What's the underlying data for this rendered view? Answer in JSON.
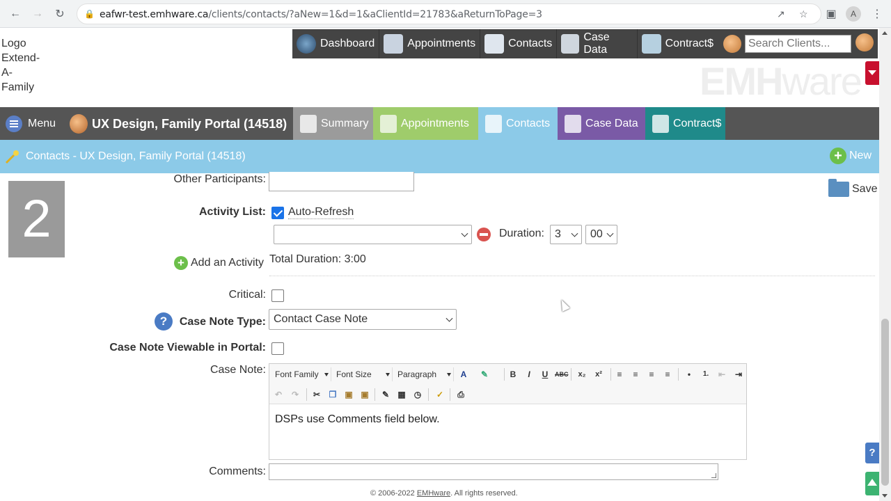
{
  "browser": {
    "url_host": "eafwr-test.emhware.ca",
    "url_rest": "/clients/contacts/?aNew=1&d=1&aClientId=21783&aReturnToPage=3",
    "profile_initial": "A"
  },
  "logo": {
    "alt_text": "Logo Extend-A-Family"
  },
  "top_nav": {
    "items": [
      {
        "label": "Dashboard",
        "icon": "dashboard-icon"
      },
      {
        "label": "Appointments",
        "icon": "calendar-icon"
      },
      {
        "label": "Contacts",
        "icon": "contacts-icon"
      },
      {
        "label": "Case Data",
        "icon": "case-data-icon"
      },
      {
        "label": "Contract$",
        "icon": "contract-icon"
      }
    ],
    "search_placeholder": "Search Clients..."
  },
  "watermark": {
    "part1": "EMH",
    "part2": "ware"
  },
  "client_bar": {
    "menu_label": "Menu",
    "client_name": "UX Design, Family Portal (14518)",
    "tabs": [
      {
        "label": "Summary",
        "color": "#9b9b9b"
      },
      {
        "label": "Appointments",
        "color": "#9fcc6b"
      },
      {
        "label": "Contacts",
        "color": "#8ccae8"
      },
      {
        "label": "Case Data",
        "color": "#7a5aa6"
      },
      {
        "label": "Contract$",
        "color": "#1f8a8a"
      }
    ]
  },
  "title_bar": {
    "title": "Contacts - UX Design, Family Portal (14518)",
    "new_label": "New"
  },
  "form": {
    "step_number": "2",
    "save_label": "Save",
    "other_participants_label": "Other Participants:",
    "activity_list_label": "Activity List:",
    "auto_refresh_label": "Auto-Refresh",
    "auto_refresh_checked": true,
    "activity_select_value": "",
    "duration_label": "Duration:",
    "duration_hours": "3",
    "duration_minutes": "00",
    "add_activity_label": "Add an Activity",
    "total_duration": "Total Duration: 3:00",
    "critical_label": "Critical:",
    "case_note_type_label": "Case Note Type:",
    "case_note_type_value": "Contact Case Note",
    "viewable_label": "Case Note Viewable in Portal:",
    "case_note_label": "Case Note:",
    "editor": {
      "font_family": "Font Family",
      "font_size": "Font Size",
      "paragraph": "Paragraph",
      "content": "DSPs use Comments field below."
    },
    "comments_label": "Comments:"
  },
  "footer": {
    "prefix": "© 2006-2022 ",
    "link": "EMHware",
    "suffix": ". All rights reserved."
  }
}
